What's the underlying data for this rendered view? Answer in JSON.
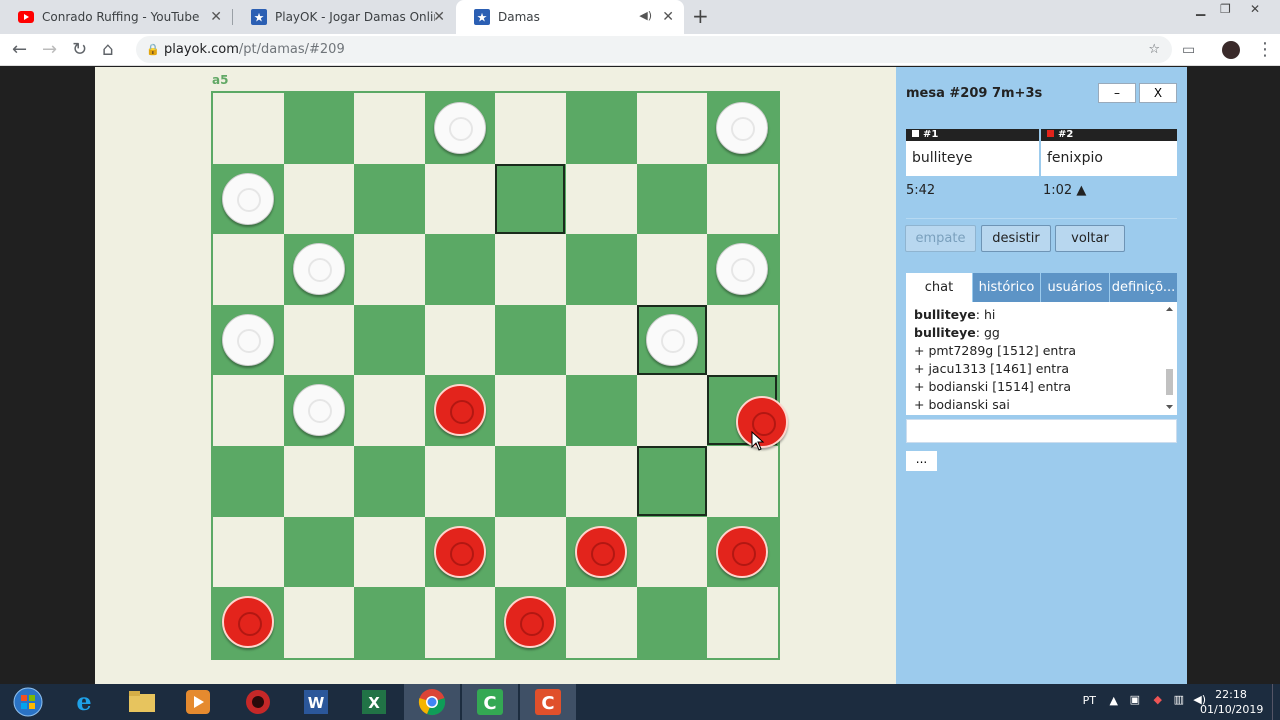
{
  "browser": {
    "tabs": [
      {
        "title": "Conrado Ruffing - YouTube",
        "icon": "youtube-icon"
      },
      {
        "title": "PlayOK - Jogar Damas Online grá",
        "icon": "playok-star-icon"
      },
      {
        "title": "Damas",
        "icon": "playok-star-icon",
        "active": true
      }
    ],
    "url_host": "playok.com",
    "url_path": "/pt/damas/#209"
  },
  "game": {
    "coord_label": "a5",
    "table_title": "mesa #209   7m+3s",
    "minimize_label": "–",
    "close_label": "X",
    "players": [
      {
        "slot": "#1",
        "color": "white",
        "name": "bulliteye",
        "time": "5:42"
      },
      {
        "slot": "#2",
        "color": "red",
        "name": "fenixpio",
        "time": "1:02 ▲"
      }
    ],
    "buttons": {
      "draw": "empate",
      "resign": "desistir",
      "undo": "voltar"
    },
    "tabs": [
      "chat",
      "histórico",
      "usuários",
      "definiçõ..."
    ],
    "chat": [
      {
        "user": "bulliteye",
        "text": ": hi"
      },
      {
        "user": "bulliteye",
        "text": ": gg"
      },
      {
        "user": "",
        "text": "+ pmt7289g [1512] entra"
      },
      {
        "user": "",
        "text": "+ jacu1313 [1461] entra"
      },
      {
        "user": "",
        "text": "+ bodianski [1514] entra"
      },
      {
        "user": "",
        "text": "+ bodianski sai"
      }
    ],
    "more_label": "...",
    "board": {
      "white_pieces": [
        "d8",
        "h8",
        "a7",
        "b6",
        "h6",
        "a5",
        "g5",
        "b4"
      ],
      "red_pieces": [
        "d4",
        "h4",
        "d2",
        "f2",
        "h2",
        "a1",
        "e1"
      ],
      "highlighted_squares": [
        "e7",
        "g5",
        "h4",
        "g3"
      ]
    }
  },
  "system": {
    "lang": "PT",
    "time": "22:18",
    "date": "01/10/2019"
  },
  "colors": {
    "dark_square": "#5ba965",
    "light_square": "#f0f0e1",
    "panel": "#9ccbed",
    "red_piece": "#e3241c"
  }
}
